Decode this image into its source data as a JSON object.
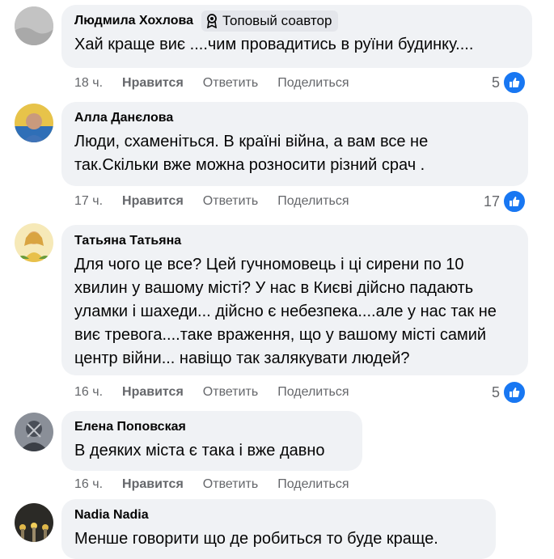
{
  "comments": [
    {
      "author": "Людмила Хохлова",
      "badge": "Топовый соавтор",
      "text": "Хай краще виє ....чим провадитись в руїни будинку....",
      "time": "18 ч.",
      "like": "Нравится",
      "reply": "Ответить",
      "share": "Поделиться",
      "reactions": "5"
    },
    {
      "author": "Алла Данєлова",
      "text": "Люди, схаменіться. В країні війна, а вам все не так.Скільки вже можна розносити різний срач .",
      "time": "17 ч.",
      "like": "Нравится",
      "reply": "Ответить",
      "share": "Поделиться",
      "reactions": "17"
    },
    {
      "author": "Татьяна Татьяна",
      "text": "Для чого це все? Цей гучномовець і ці сирени по 10 хвилин у вашому місті? У нас в Києві дійсно падають уламки і шахеди... дійсно є небезпека....але у нас так не виє тревога....таке враження, що у вашому місті самий центр війни... навіщо так залякувати людей?",
      "time": "16 ч.",
      "like": "Нравится",
      "reply": "Ответить",
      "share": "Поделиться",
      "reactions": "5"
    },
    {
      "author": "Елена Поповская",
      "text": "В деяких міста є така і вже давно",
      "time": "16 ч.",
      "like": "Нравится",
      "reply": "Ответить",
      "share": "Поделиться"
    },
    {
      "author": "Nadia Nadia",
      "text": "Менше говорити що де робиться то буде краще."
    }
  ],
  "colors": {
    "bubble": "#f0f2f5",
    "meta": "#65676b",
    "like_blue": "#1877f2"
  },
  "icons": {
    "badge": "contributor-badge-icon",
    "reaction": "thumbs-up-icon"
  }
}
